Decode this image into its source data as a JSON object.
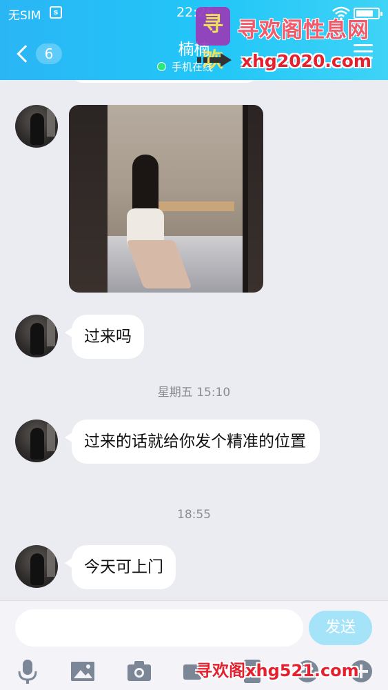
{
  "status_bar": {
    "carrier": "无SIM",
    "sim_icon": "s",
    "time": "22:25",
    "wifi_icon": "wifi-icon",
    "battery_level": 0.8
  },
  "header": {
    "back_count": "6",
    "contact_name": "楠楠",
    "presence": "手机在线",
    "presence_color": "#2ee87e"
  },
  "watermark": {
    "logo_text": "寻欢",
    "title": "寻欢阁性息网",
    "url_top": "xhg2020.com",
    "url_bottom": "寻欢阁xhg521.com",
    "color": "#e5212f"
  },
  "messages": [
    {
      "type": "image",
      "alt": "photo message"
    },
    {
      "type": "text",
      "text": "过来吗"
    },
    {
      "type": "time",
      "text": "星期五 15:10"
    },
    {
      "type": "text",
      "text": "过来的话就给你发个精准的位置"
    },
    {
      "type": "time",
      "text": "18:55"
    },
    {
      "type": "text",
      "text": "今天可上门"
    }
  ],
  "composer": {
    "placeholder": "",
    "send_label": "发送"
  },
  "toolbar": [
    "microphone-icon",
    "image-icon",
    "camera-icon",
    "video-icon",
    "red-packet-icon",
    "emoji-icon",
    "plus-icon"
  ],
  "colors": {
    "header_start": "#2ab6f5",
    "header_end": "#3fd3f7",
    "chat_bg": "#ebebf2",
    "send_disabled": "#a5e3f8"
  }
}
